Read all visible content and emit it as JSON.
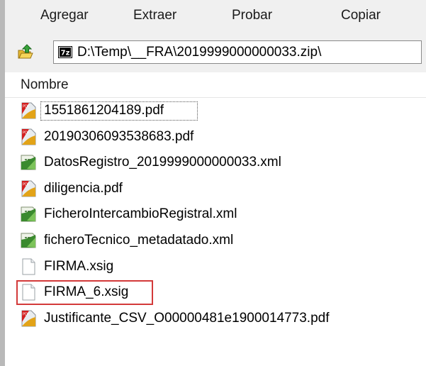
{
  "toolbar": {
    "buttons": [
      "Agregar",
      "Extraer",
      "Probar",
      "Copiar"
    ]
  },
  "addressbar": {
    "archive_icon_label": "7z",
    "path": "D:\\Temp\\__FRA\\2019999000000033.zip\\"
  },
  "file_list": {
    "header": "Nombre",
    "rows": [
      {
        "name": "1551861204189.pdf",
        "icon": "pdf-icon"
      },
      {
        "name": "20190306093538683.pdf",
        "icon": "pdf-icon"
      },
      {
        "name": "DatosRegistro_2019999000000033.xml",
        "icon": "xml-icon"
      },
      {
        "name": "diligencia.pdf",
        "icon": "pdf-icon"
      },
      {
        "name": "FicheroIntercambioRegistral.xml",
        "icon": "xml-icon"
      },
      {
        "name": "ficheroTecnico_metadatado.xml",
        "icon": "xml-icon"
      },
      {
        "name": "FIRMA.xsig",
        "icon": "blank-file-icon"
      },
      {
        "name": "FIRMA_6.xsig",
        "icon": "blank-file-icon"
      },
      {
        "name": "Justificante_CSV_O00000481e1900014773.pdf",
        "icon": "pdf-icon"
      }
    ],
    "focused_row": 0,
    "highlighted_row": 7
  },
  "colors": {
    "toolbar_bg": "#f0f0f0",
    "highlight": "#d33a3a",
    "pdf_red": "#d21f1f",
    "xml_green": "#3a8a2e"
  }
}
